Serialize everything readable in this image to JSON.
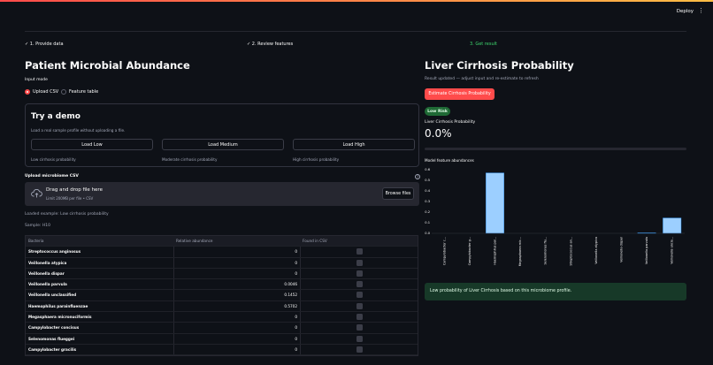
{
  "topbar": {
    "deploy_label": "Deploy",
    "menu_icon": "kebab-menu-icon"
  },
  "steps": {
    "s1": "✓ 1. Provide data",
    "s2": "✓ 2. Review features",
    "s3": "3. Get result"
  },
  "left": {
    "title": "Patient Microbial Abundance",
    "input_mode_label": "Input mode",
    "radio_upload": "Upload CSV",
    "radio_feature": "Feature table",
    "demo": {
      "title": "Try a demo",
      "subtitle": "Load a real sample profile without uploading a file.",
      "buttons": [
        {
          "label": "Load Low",
          "caption": "Low cirrhosis probability"
        },
        {
          "label": "Load Medium",
          "caption": "Moderate cirrhosis probability"
        },
        {
          "label": "Load High",
          "caption": "High cirrhosis probability"
        }
      ]
    },
    "upload_label": "Upload microbiome CSV",
    "help_icon_glyph": "?",
    "dropzone": {
      "title": "Drag and drop file here",
      "subtitle": "Limit 200MB per file • CSV",
      "browse_label": "Browse files"
    },
    "loaded_text": "Loaded example: Low cirrhosis probability",
    "sample_text": "Sample: H10",
    "table": {
      "headers": [
        "Bacteria",
        "Relative abundance",
        "Found in CSV"
      ],
      "rows": [
        {
          "name": "Streptococcus anginosus",
          "value": "0"
        },
        {
          "name": "Veillonella atypica",
          "value": "0"
        },
        {
          "name": "Veillonella dispar",
          "value": "0"
        },
        {
          "name": "Veillonella parvula",
          "value": "0.0046"
        },
        {
          "name": "Veillonella unclassified",
          "value": "0.1452"
        },
        {
          "name": "Haemophilus parainfluenzae",
          "value": "0.5702"
        },
        {
          "name": "Megasphaera micronuciformis",
          "value": "0"
        },
        {
          "name": "Campylobacter concisus",
          "value": "0"
        },
        {
          "name": "Selenomonas flueggei",
          "value": "0"
        },
        {
          "name": "Campylobacter gracilis",
          "value": "0"
        }
      ]
    }
  },
  "right": {
    "title": "Liver Cirrhosis Probability",
    "status_text": "Result updated — adjust input and re-estimate to refresh",
    "estimate_label": "Estimate Cirrhosis Probability",
    "badge": "Low Risk",
    "metric_label": "Liver Cirrhosis Probability",
    "metric_value": "0.0%",
    "progress": 0.0,
    "chart_title": "Model feature abundances",
    "result_text": "Low probability of Liver Cirrhosis based on this microbiome profile."
  },
  "chart_data": {
    "type": "bar",
    "title": "Model feature abundances",
    "categories": [
      "Campylobacter c...",
      "Campylobacter g...",
      "Haemophilus par...",
      "Megasphaera mic...",
      "Selenomonas flu...",
      "Streptococcus an...",
      "Veillonella atypica",
      "Veillonella dispar",
      "Veillonella parvula",
      "Veillonella uncla..."
    ],
    "values": [
      0,
      0,
      0.5702,
      0,
      0,
      0,
      0,
      0,
      0.0046,
      0.1452
    ],
    "yticks": [
      "0.0",
      "0.1",
      "0.2",
      "0.3",
      "0.4",
      "0.5",
      "0.6"
    ],
    "ylim": [
      0,
      0.6
    ],
    "bar_color": "#9ccfff",
    "bar_stroke": "#1c83e1"
  }
}
